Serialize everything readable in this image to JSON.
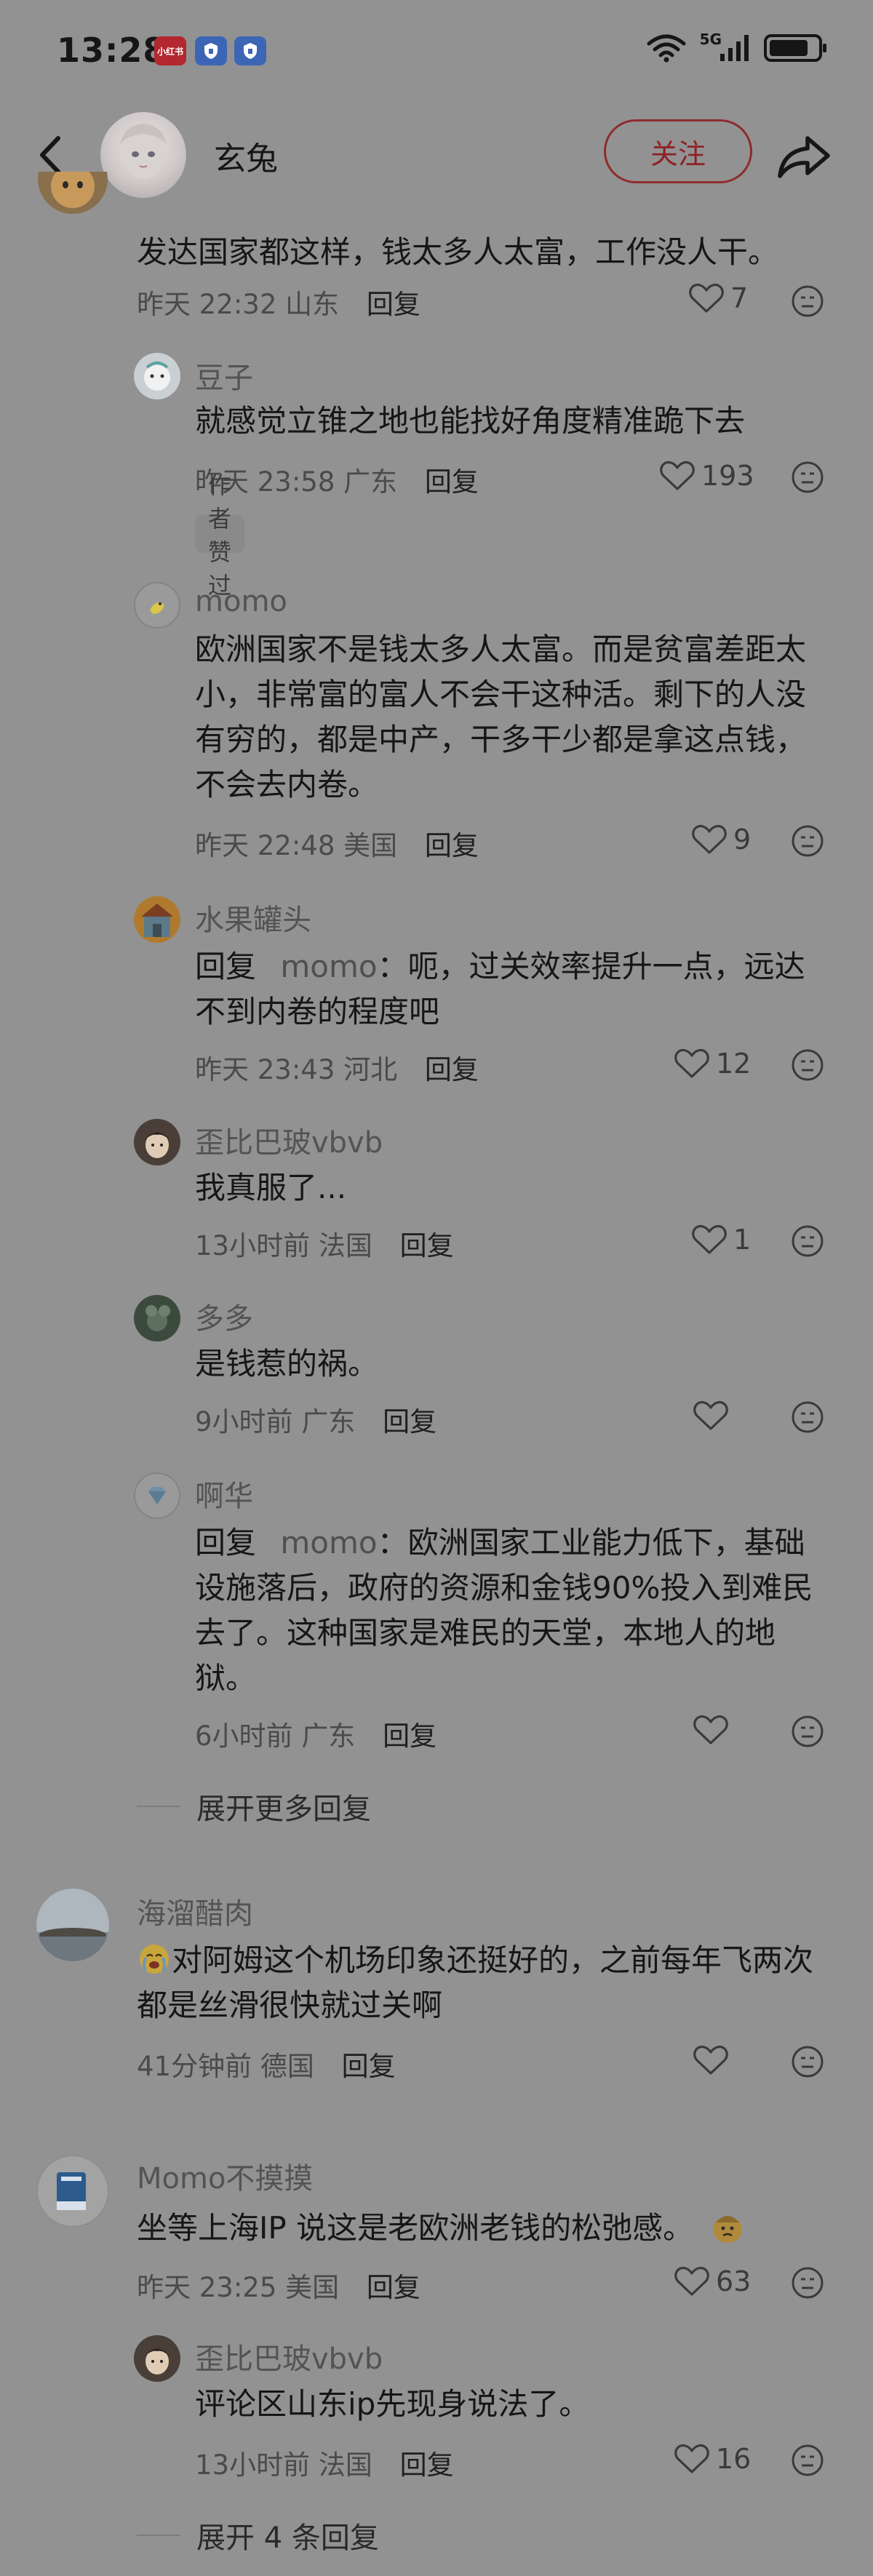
{
  "status_bar": {
    "time": "13:28",
    "badges": [
      "小红书",
      "",
      ""
    ],
    "network": "5G",
    "battery_level": 0.82
  },
  "header": {
    "user_name": "玄兔",
    "follow_label": "关注"
  },
  "colors": {
    "background": "#929292",
    "follow_accent": "#8e2226",
    "text_primary": "#161616",
    "text_secondary": "#4a4a4a"
  },
  "comments": [
    {
      "content": "发达国家都这样，钱太多人太富，工作没人干。",
      "time": "昨天 22:32",
      "location": "山东",
      "reply_label": "回复",
      "likes": "7",
      "replies": [
        {
          "user": "豆子",
          "content": "就感觉立锥之地也能找好角度精准跪下去",
          "time": "昨天 23:58",
          "location": "广东",
          "reply_label": "回复",
          "likes": "193",
          "badge": "作者赞过"
        },
        {
          "user": "momo",
          "content": "欧洲国家不是钱太多人太富。而是贫富差距太小，非常富的富人不会干这种活。剩下的人没有穷的，都是中产，干多干少都是拿这点钱，不会去内卷。",
          "time": "昨天 22:48",
          "location": "美国",
          "reply_label": "回复",
          "likes": "9"
        },
        {
          "user": "水果罐头",
          "prefix": "回复",
          "mention": "momo",
          "content": "：呃，过关效率提升一点，远达不到内卷的程度吧",
          "time": "昨天 23:43",
          "location": "河北",
          "reply_label": "回复",
          "likes": "12"
        },
        {
          "user": "歪比巴玻vbvb",
          "content": "我真服了...",
          "time": "13小时前",
          "location": "法国",
          "reply_label": "回复",
          "likes": "1"
        },
        {
          "user": "多多",
          "content": "是钱惹的祸。",
          "time": "9小时前",
          "location": "广东",
          "reply_label": "回复",
          "likes": ""
        },
        {
          "user": "啊华",
          "prefix": "回复",
          "mention": "momo",
          "content": "：欧洲国家工业能力低下，基础设施落后，政府的资源和金钱90%投入到难民去了。这种国家是难民的天堂，本地人的地狱。",
          "time": "6小时前",
          "location": "广东",
          "reply_label": "回复",
          "likes": ""
        }
      ],
      "expand_label": "展开更多回复"
    },
    {
      "user": "海溜醋肉",
      "content": "对阿姆这个机场印象还挺好的，之前每年飞两次 都是丝滑很快就过关啊",
      "time": "41分钟前",
      "location": "德国",
      "reply_label": "回复",
      "likes": ""
    },
    {
      "user": "Momo不摸摸",
      "content": "坐等上海IP 说这是老欧洲老钱的松弛感。",
      "time": "昨天 23:25",
      "location": "美国",
      "reply_label": "回复",
      "likes": "63",
      "replies": [
        {
          "user": "歪比巴玻vbvb",
          "content": "评论区山东ip先现身说法了。",
          "time": "13小时前",
          "location": "法国",
          "reply_label": "回复",
          "likes": "16"
        }
      ],
      "expand_label": "展开 4 条回复"
    }
  ]
}
